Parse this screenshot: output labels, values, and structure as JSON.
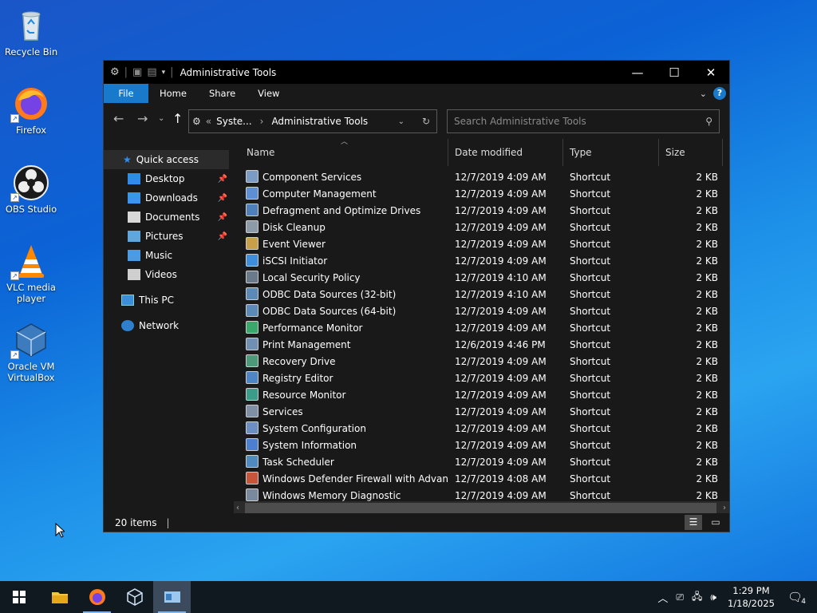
{
  "desktop": {
    "icons": [
      {
        "label": "Recycle Bin",
        "icon": "recycle-bin-icon"
      },
      {
        "label": "Firefox",
        "icon": "firefox-icon"
      },
      {
        "label": "OBS Studio",
        "icon": "obs-icon"
      },
      {
        "label": "VLC media player",
        "icon": "vlc-icon"
      },
      {
        "label": "Oracle VM VirtualBox",
        "icon": "virtualbox-icon"
      }
    ]
  },
  "window": {
    "title": "Administrative Tools",
    "tabs": {
      "file": "File",
      "home": "Home",
      "share": "Share",
      "view": "View"
    },
    "help": "?",
    "address": {
      "crumb_parent": "Syste...",
      "crumb_current": "Administrative Tools",
      "prefix": "«"
    },
    "search": {
      "placeholder": "Search Administrative Tools"
    },
    "columns": {
      "name": "Name",
      "date": "Date modified",
      "type": "Type",
      "size": "Size"
    },
    "sidebar": {
      "quick_access": "Quick access",
      "items": [
        {
          "label": "Desktop",
          "pinned": true,
          "color": "#2f8ce8"
        },
        {
          "label": "Downloads",
          "pinned": true,
          "color": "#3a96ea"
        },
        {
          "label": "Documents",
          "pinned": true,
          "color": "#d8d8d8"
        },
        {
          "label": "Pictures",
          "pinned": true,
          "color": "#5fa6dc"
        },
        {
          "label": "Music",
          "pinned": false,
          "color": "#4a9be4"
        },
        {
          "label": "Videos",
          "pinned": false,
          "color": "#cfcfcf"
        }
      ],
      "this_pc": "This PC",
      "network": "Network"
    },
    "files": [
      {
        "name": "Component Services",
        "date": "12/7/2019 4:09 AM",
        "type": "Shortcut",
        "size": "2 KB"
      },
      {
        "name": "Computer Management",
        "date": "12/7/2019 4:09 AM",
        "type": "Shortcut",
        "size": "2 KB"
      },
      {
        "name": "Defragment and Optimize Drives",
        "date": "12/7/2019 4:09 AM",
        "type": "Shortcut",
        "size": "2 KB"
      },
      {
        "name": "Disk Cleanup",
        "date": "12/7/2019 4:09 AM",
        "type": "Shortcut",
        "size": "2 KB"
      },
      {
        "name": "Event Viewer",
        "date": "12/7/2019 4:09 AM",
        "type": "Shortcut",
        "size": "2 KB"
      },
      {
        "name": "iSCSI Initiator",
        "date": "12/7/2019 4:09 AM",
        "type": "Shortcut",
        "size": "2 KB"
      },
      {
        "name": "Local Security Policy",
        "date": "12/7/2019 4:10 AM",
        "type": "Shortcut",
        "size": "2 KB"
      },
      {
        "name": "ODBC Data Sources (32-bit)",
        "date": "12/7/2019 4:10 AM",
        "type": "Shortcut",
        "size": "2 KB"
      },
      {
        "name": "ODBC Data Sources (64-bit)",
        "date": "12/7/2019 4:09 AM",
        "type": "Shortcut",
        "size": "2 KB"
      },
      {
        "name": "Performance Monitor",
        "date": "12/7/2019 4:09 AM",
        "type": "Shortcut",
        "size": "2 KB"
      },
      {
        "name": "Print Management",
        "date": "12/6/2019 4:46 PM",
        "type": "Shortcut",
        "size": "2 KB"
      },
      {
        "name": "Recovery Drive",
        "date": "12/7/2019 4:09 AM",
        "type": "Shortcut",
        "size": "2 KB"
      },
      {
        "name": "Registry Editor",
        "date": "12/7/2019 4:09 AM",
        "type": "Shortcut",
        "size": "2 KB"
      },
      {
        "name": "Resource Monitor",
        "date": "12/7/2019 4:09 AM",
        "type": "Shortcut",
        "size": "2 KB"
      },
      {
        "name": "Services",
        "date": "12/7/2019 4:09 AM",
        "type": "Shortcut",
        "size": "2 KB"
      },
      {
        "name": "System Configuration",
        "date": "12/7/2019 4:09 AM",
        "type": "Shortcut",
        "size": "2 KB"
      },
      {
        "name": "System Information",
        "date": "12/7/2019 4:09 AM",
        "type": "Shortcut",
        "size": "2 KB"
      },
      {
        "name": "Task Scheduler",
        "date": "12/7/2019 4:09 AM",
        "type": "Shortcut",
        "size": "2 KB"
      },
      {
        "name": "Windows Defender Firewall with Advanc...",
        "date": "12/7/2019 4:08 AM",
        "type": "Shortcut",
        "size": "2 KB"
      },
      {
        "name": "Windows Memory Diagnostic",
        "date": "12/7/2019 4:09 AM",
        "type": "Shortcut",
        "size": "2 KB"
      }
    ],
    "status": "20 items"
  },
  "taskbar": {
    "time": "1:29 PM",
    "date": "1/18/2025",
    "notifications": "4"
  },
  "colors": {
    "accent": "#1979ca",
    "titlebar": "#000000",
    "window_bg": "#191919",
    "taskbar": "#101820"
  }
}
